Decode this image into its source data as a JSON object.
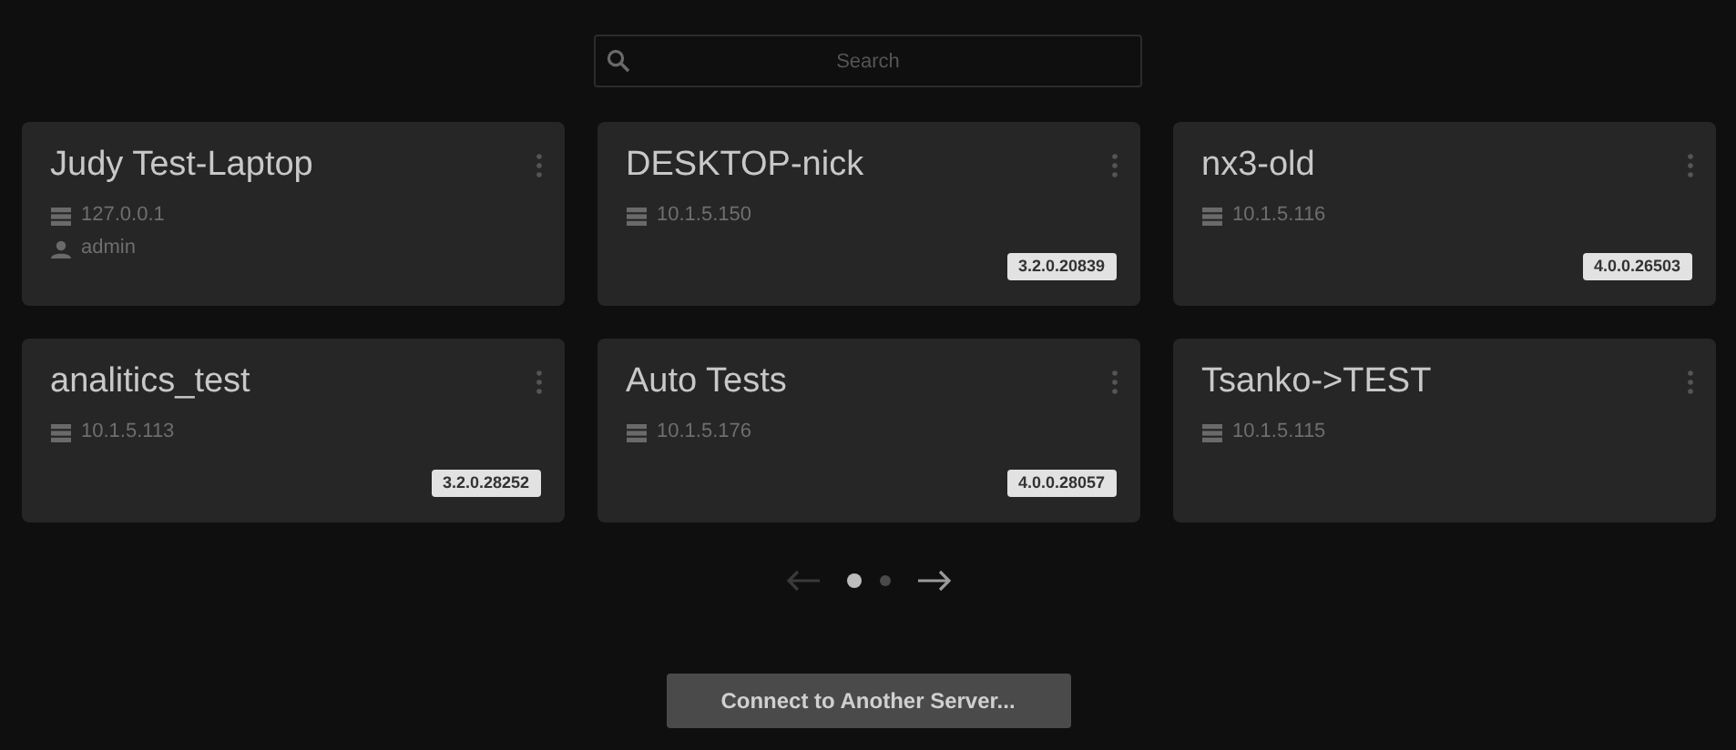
{
  "search": {
    "placeholder": "Search"
  },
  "servers": [
    {
      "name": "Judy Test-Laptop",
      "address": "127.0.0.1",
      "user": "admin"
    },
    {
      "name": "DESKTOP-nick",
      "address": "10.1.5.150",
      "version": "3.2.0.20839"
    },
    {
      "name": "nx3-old",
      "address": "10.1.5.116",
      "version": "4.0.0.26503"
    },
    {
      "name": "analitics_test",
      "address": "10.1.5.113",
      "version": "3.2.0.28252"
    },
    {
      "name": "Auto Tests",
      "address": "10.1.5.176",
      "version": "4.0.0.28057"
    },
    {
      "name": "Tsanko->TEST",
      "address": "10.1.5.115"
    }
  ],
  "pagination": {
    "previous": {
      "disabled": true
    },
    "next": {
      "disabled": false
    },
    "pages": [
      {
        "selected": true
      },
      {
        "selected": false
      }
    ]
  },
  "connect_button": "Connect to Another Server..."
}
